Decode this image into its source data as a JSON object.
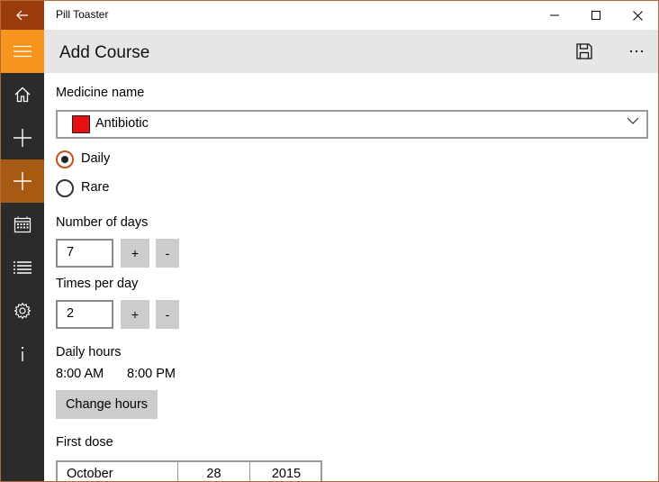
{
  "app": {
    "title": "Pill Toaster"
  },
  "header": {
    "title": "Add Course"
  },
  "form": {
    "medicine_label": "Medicine name",
    "medicine_value": "Antibiotic",
    "medicine_color": "#e81010",
    "frequency_options": [
      {
        "label": "Daily",
        "checked": true
      },
      {
        "label": "Rare",
        "checked": false
      }
    ],
    "days_label": "Number of days",
    "days_value": "7",
    "times_label": "Times per day",
    "times_value": "2",
    "plus_label": "+",
    "minus_label": "-",
    "hours_label": "Daily hours",
    "hours_values": [
      "8:00 AM",
      "8:00 PM"
    ],
    "change_hours_label": "Change hours",
    "first_dose_label": "First dose",
    "first_dose": {
      "month": "October",
      "day": "28",
      "year": "2015"
    }
  },
  "colors": {
    "accent": "#f7941d",
    "accent_dark": "#a65a12",
    "back_button": "#9a3b0c",
    "sidebar": "#2b2b2b",
    "header": "#e6e6e6"
  },
  "icons": {
    "back": "back-arrow-icon",
    "minimize": "minimize-icon",
    "maximize": "maximize-icon",
    "close": "close-icon",
    "hamburger": "hamburger-menu-icon",
    "home": "home-icon",
    "add": "plus-icon",
    "add_course": "plus-icon",
    "calendar": "calendar-icon",
    "list": "list-icon",
    "settings": "gear-icon",
    "info": "info-icon",
    "save": "save-icon",
    "more": "more-icon",
    "chevron": "chevron-down-icon"
  }
}
